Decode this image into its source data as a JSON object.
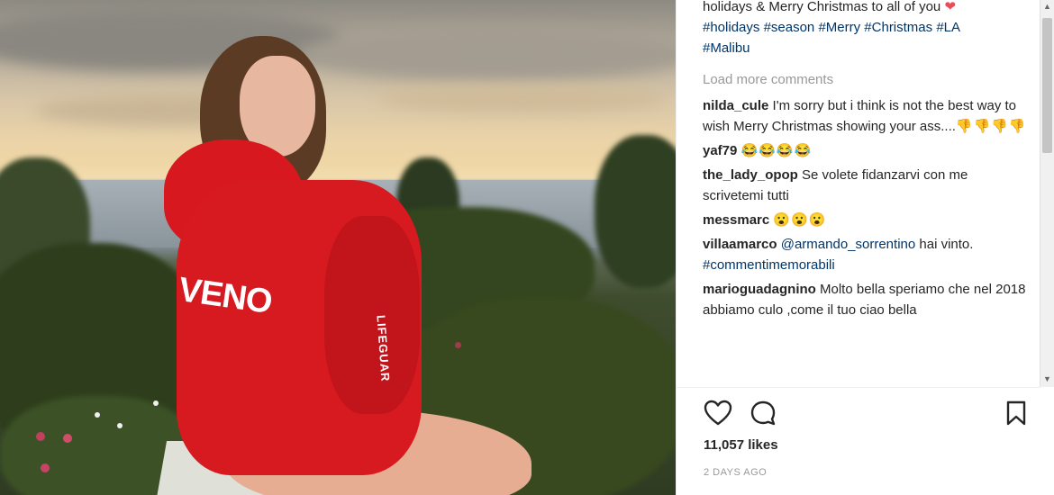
{
  "post": {
    "caption_tail": "holidays & Merry Christmas to all of you",
    "caption_heart": "❤",
    "hashtags": [
      "#holidays",
      "#season",
      "#Merry",
      "#Christmas",
      "#LA",
      "#Malibu"
    ],
    "hoodie_print": "VENO",
    "sleeve_print": "LIFEGUAR"
  },
  "comments": {
    "load_more_label": "Load more comments",
    "items": [
      {
        "user": "nilda_cule",
        "text": "I'm sorry but i think is not the best way to wish Merry Christmas showing your ass....",
        "emoji": "👎👎👎👎"
      },
      {
        "user": "yaf79",
        "text": "",
        "emoji": "😂😂😂😂"
      },
      {
        "user": "the_lady_opop",
        "text": "Se volete fidanzarvi con me scrivetemi tutti",
        "emoji": ""
      },
      {
        "user": "messmarc",
        "text": "",
        "emoji": "😮😮😮"
      },
      {
        "user": "villaamarco",
        "mention": "@armando_sorrentino",
        "text": "hai vinto.",
        "hashtag": "#commentimemorabili"
      },
      {
        "user": "marioguadagnino",
        "text": "Molto bella speriamo che nel 2018 abbiamo culo ,come il tuo ciao bella",
        "emoji": ""
      }
    ]
  },
  "footer": {
    "likes": "11,057 likes",
    "date": "2 DAYS AGO"
  },
  "colors": {
    "hashtag": "#003569",
    "muted": "#999999",
    "hoodie": "#d71920"
  },
  "icons": {
    "like": "heart-outline-icon",
    "comment": "comment-bubble-icon",
    "save": "bookmark-icon"
  }
}
